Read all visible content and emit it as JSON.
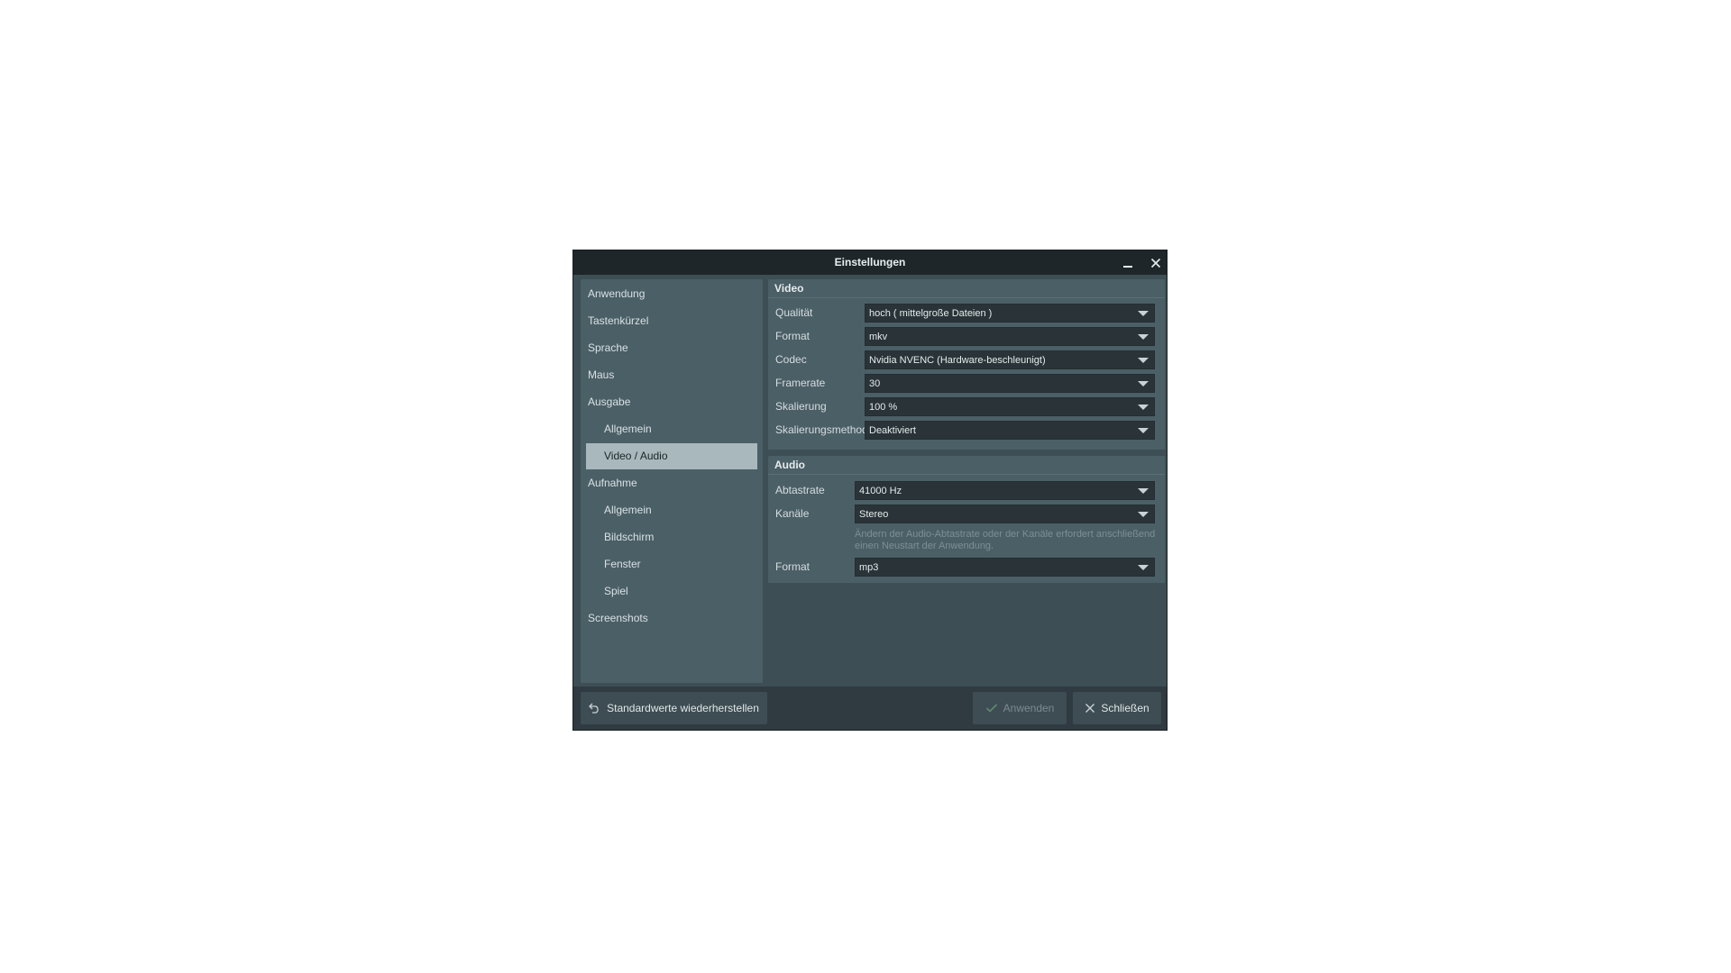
{
  "window": {
    "title": "Einstellungen"
  },
  "sidebar": {
    "items": [
      {
        "label": "Anwendung",
        "level": 0,
        "active": false
      },
      {
        "label": "Tastenkürzel",
        "level": 0,
        "active": false
      },
      {
        "label": "Sprache",
        "level": 0,
        "active": false
      },
      {
        "label": "Maus",
        "level": 0,
        "active": false
      },
      {
        "label": "Ausgabe",
        "level": 0,
        "active": false
      },
      {
        "label": "Allgemein",
        "level": 1,
        "active": false
      },
      {
        "label": "Video / Audio",
        "level": 1,
        "active": true
      },
      {
        "label": "Aufnahme",
        "level": 0,
        "active": false
      },
      {
        "label": "Allgemein",
        "level": 1,
        "active": false
      },
      {
        "label": "Bildschirm",
        "level": 1,
        "active": false
      },
      {
        "label": "Fenster",
        "level": 1,
        "active": false
      },
      {
        "label": "Spiel",
        "level": 1,
        "active": false
      },
      {
        "label": "Screenshots",
        "level": 0,
        "active": false
      }
    ]
  },
  "video": {
    "heading": "Video",
    "fields": [
      {
        "label": "Qualität",
        "value": "hoch ( mittelgroße Dateien )"
      },
      {
        "label": "Format",
        "value": "mkv"
      },
      {
        "label": "Codec",
        "value": "Nvidia NVENC (Hardware-beschleunigt)"
      },
      {
        "label": "Framerate",
        "value": "30"
      },
      {
        "label": "Skalierung",
        "value": "100 %"
      },
      {
        "label": "Skalierungsmethode",
        "value": "Deaktiviert"
      }
    ]
  },
  "audio": {
    "heading": "Audio",
    "fields": [
      {
        "label": "Abtastrate",
        "value": "41000 Hz"
      },
      {
        "label": "Kanäle",
        "value": "Stereo"
      },
      {
        "label": "Format",
        "value": "mp3"
      }
    ],
    "note_line1": "Ändern der Audio-Abtastrate oder der Kanäle erfordert anschließend",
    "note_line2": "einen Neustart der Anwendung."
  },
  "footer": {
    "restore_label": "Standardwerte wiederherstellen",
    "apply_label": "Anwenden",
    "close_label": "Schließen"
  },
  "icons": {
    "minimize": "minimize-icon",
    "close": "close-icon",
    "restore": "undo-icon",
    "apply": "check-icon",
    "footer_close": "close-icon"
  },
  "colors": {
    "titlebar": "#1e2629",
    "window_bg": "#3d4f55",
    "panel_bg": "#4b5f66",
    "active_item": "#a9b8bc",
    "combo_bg": "#2a3438",
    "footer_bg": "#2f3b40"
  }
}
